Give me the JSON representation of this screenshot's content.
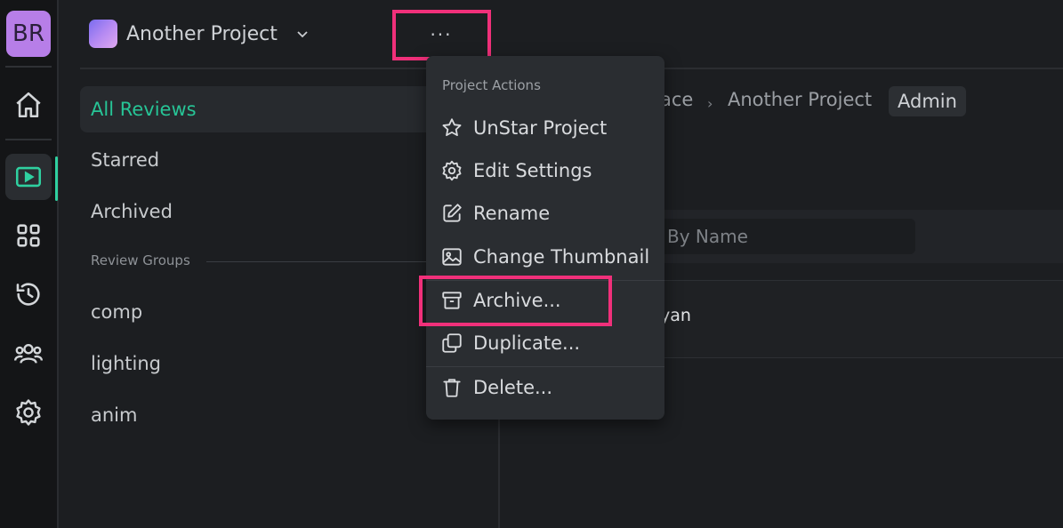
{
  "rail": {
    "avatar_initials": "BR",
    "icons": [
      "home-icon",
      "reviews-play-icon",
      "apps-grid-icon",
      "history-icon",
      "team-icon",
      "settings-gear-icon"
    ]
  },
  "header": {
    "project_name": "Another Project",
    "more_label": "···"
  },
  "sidebar": {
    "items": [
      {
        "label": "All Reviews",
        "selected": true
      },
      {
        "label": "Starred"
      },
      {
        "label": "Archived"
      }
    ],
    "group_title": "Review Groups",
    "groups": [
      "comp",
      "lighting",
      "anim"
    ]
  },
  "main": {
    "breadcrumb_partial": "ace",
    "breadcrumb_project": "Another Project",
    "breadcrumb_separator": "›",
    "role_badge": "Admin",
    "search_placeholder_partial": "By Name",
    "row_text_partial": "yan"
  },
  "menu": {
    "title": "Project Actions",
    "items": [
      {
        "label": "UnStar Project",
        "icon": "star-icon"
      },
      {
        "label": "Edit Settings",
        "icon": "gear-icon"
      },
      {
        "label": "Rename",
        "icon": "edit-icon"
      },
      {
        "label": "Change Thumbnail",
        "icon": "image-icon"
      },
      {
        "label": "Archive...",
        "icon": "archive-icon"
      },
      {
        "label": "Duplicate...",
        "icon": "duplicate-icon"
      },
      {
        "label": "Delete...",
        "icon": "trash-icon"
      }
    ]
  },
  "colors": {
    "accent_green": "#27c496",
    "highlight_pink": "#f0307a",
    "avatar_purple": "#b77ee8"
  }
}
